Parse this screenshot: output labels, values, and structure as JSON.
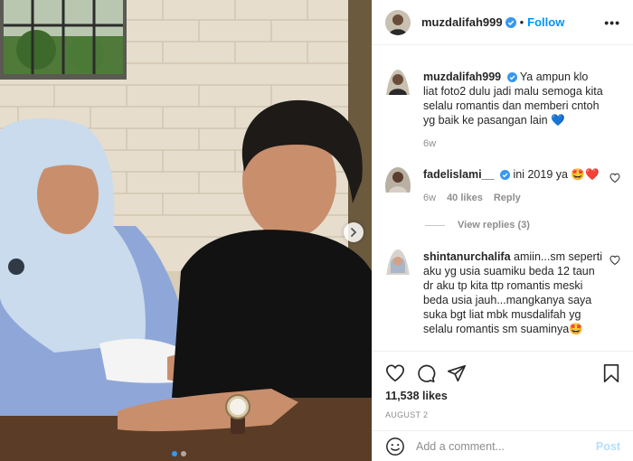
{
  "post": {
    "username": "muzdalifah999",
    "follow_label": "Follow",
    "separator": "•",
    "more_label": "•••",
    "caption": {
      "username": "muzdalifah999",
      "text": "Ya ampun klo liat foto2 dulu jadi malu semoga kita selalu romantis dan memberi cntoh yg baik ke pasangan lain 💙",
      "time": "6w"
    },
    "comments": [
      {
        "username": "fadelislami__",
        "text": "ini 2019 ya 🤩❤️",
        "time": "6w",
        "likes": "40 likes",
        "reply_label": "Reply",
        "view_replies": "View replies (3)"
      },
      {
        "username": "shintanurchalifa",
        "text": "amiin...sm seperti aku yg usia suamiku beda 12 taun dr aku tp kita ttp romantis meski beda usia jauh...mangkanya saya suka bgt liat mbk musdalifah yg selalu romantis sm suaminya🤩"
      }
    ],
    "like_count": "11,538 likes",
    "date": "AUGUST 2",
    "comment_placeholder": "Add a comment...",
    "post_button": "Post"
  },
  "carousel": {
    "slides": 2,
    "active_index": 0
  },
  "colors": {
    "accent": "#0095f6",
    "verified": "#3897f0",
    "post_disabled": "#b2dffc",
    "muted": "#8e8e8e"
  },
  "icons": [
    "verified-badge-icon",
    "heart-icon",
    "comment-icon",
    "share-icon",
    "bookmark-icon",
    "smiley-icon",
    "chevron-right-icon"
  ]
}
